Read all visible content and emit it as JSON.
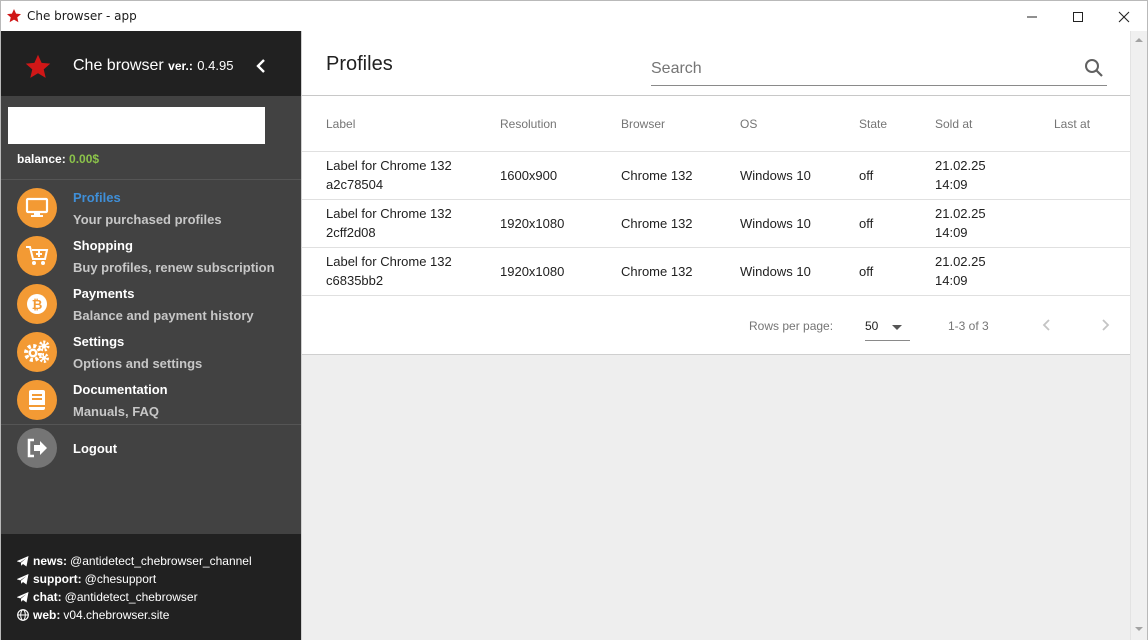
{
  "window": {
    "title": "Che browser - app",
    "icons": {
      "app": "star-icon",
      "minimize": "minimize-icon",
      "maximize": "maximize-icon",
      "close": "close-icon"
    }
  },
  "sidebar": {
    "app_name": "Che browser",
    "version_label": "ver.:",
    "version": "0.4.95",
    "balance_label": "balance:",
    "balance_value": "0.00$",
    "items": [
      {
        "title": "Profiles",
        "subtitle": "Your purchased profiles",
        "icon": "monitor-icon",
        "active": true
      },
      {
        "title": "Shopping",
        "subtitle": "Buy profiles, renew subscription",
        "icon": "cart-icon",
        "active": false
      },
      {
        "title": "Payments",
        "subtitle": "Balance and payment history",
        "icon": "bitcoin-icon",
        "active": false
      },
      {
        "title": "Settings",
        "subtitle": "Options and settings",
        "icon": "cogs-icon",
        "active": false
      },
      {
        "title": "Documentation",
        "subtitle": "Manuals, FAQ",
        "icon": "book-icon",
        "active": false
      }
    ],
    "logout": "Logout",
    "footer": [
      {
        "label": "news:",
        "value": "@antidetect_chebrowser_channel",
        "icon": "telegram-icon"
      },
      {
        "label": "support:",
        "value": "@chesupport",
        "icon": "telegram-icon"
      },
      {
        "label": "chat:",
        "value": "@antidetect_chebrowser",
        "icon": "telegram-icon"
      },
      {
        "label": "web:",
        "value": "v04.chebrowser.site",
        "icon": "globe-icon"
      }
    ],
    "colors": {
      "accent": "#f39a34",
      "active": "#3f8fd8",
      "balance": "#8bc34a"
    }
  },
  "main": {
    "title": "Profiles",
    "search_placeholder": "Search",
    "columns": [
      "Label",
      "Resolution",
      "Browser",
      "OS",
      "State",
      "Sold at",
      "Last at"
    ],
    "rows": [
      {
        "label_1": "Label for Chrome 132",
        "label_2": "a2c78504",
        "resolution": "1600x900",
        "browser": "Chrome 132",
        "os": "Windows 10",
        "state": "off",
        "sold_date": "21.02.25",
        "sold_time": "14:09",
        "last_at": ""
      },
      {
        "label_1": "Label for Chrome 132",
        "label_2": "2cff2d08",
        "resolution": "1920x1080",
        "browser": "Chrome 132",
        "os": "Windows 10",
        "state": "off",
        "sold_date": "21.02.25",
        "sold_time": "14:09",
        "last_at": ""
      },
      {
        "label_1": "Label for Chrome 132",
        "label_2": "c6835bb2",
        "resolution": "1920x1080",
        "browser": "Chrome 132",
        "os": "Windows 10",
        "state": "off",
        "sold_date": "21.02.25",
        "sold_time": "14:09",
        "last_at": ""
      }
    ],
    "pagination": {
      "rows_per_page_label": "Rows per page:",
      "rows_per_page": "50",
      "range": "1-3 of 3"
    }
  }
}
